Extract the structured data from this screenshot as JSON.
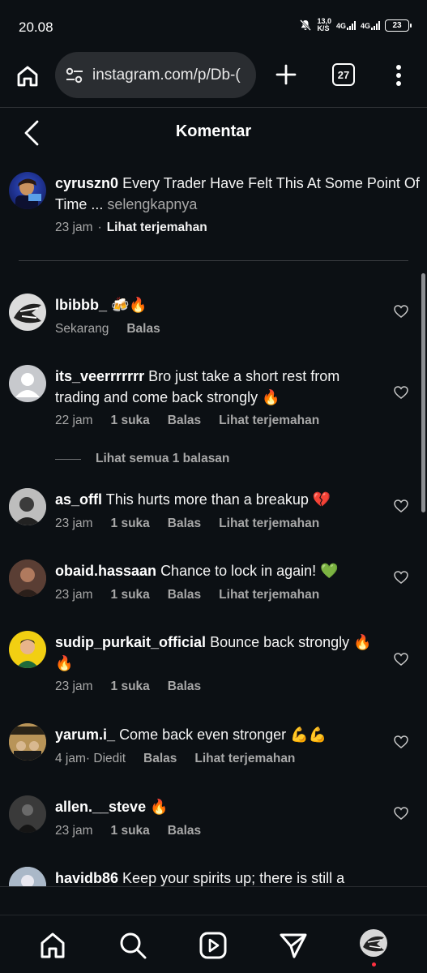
{
  "status_bar": {
    "time": "20.08",
    "speed_value": "13,0",
    "speed_unit": "K/S",
    "net1": "4G",
    "net2": "4G",
    "battery": "23"
  },
  "browser": {
    "url": "instagram.com/p/Db-(",
    "tab_count": "27"
  },
  "header": {
    "title": "Komentar"
  },
  "caption": {
    "username": "cyruszn0",
    "text": "Every Trader Have Felt This At Some Point Of Time ...",
    "more": "selengkapnya",
    "time": "23 jam",
    "translate": "Lihat terjemahan"
  },
  "comments": [
    {
      "username": "lbibbb_",
      "text": "🍻🔥",
      "time": "Sekarang",
      "likes": "",
      "reply": "Balas",
      "translate": ""
    },
    {
      "username": "its_veerrrrrrr",
      "text": "Bro just take a short rest from trading and come back strongly 🔥",
      "time": "22 jam",
      "likes": "1 suka",
      "reply": "Balas",
      "translate": "Lihat terjemahan"
    },
    {
      "username": "as_offl",
      "text": "This hurts more than a breakup 💔",
      "time": "23 jam",
      "likes": "1 suka",
      "reply": "Balas",
      "translate": "Lihat terjemahan"
    },
    {
      "username": "obaid.hassaan",
      "text": "Chance to lock in again! 💚",
      "time": "23 jam",
      "likes": "1 suka",
      "reply": "Balas",
      "translate": "Lihat terjemahan"
    },
    {
      "username": "sudip_purkait_official",
      "text": "Bounce back strongly 🔥🔥",
      "time": "23 jam",
      "likes": "1 suka",
      "reply": "Balas",
      "translate": ""
    },
    {
      "username": "yarum.i_",
      "text": "Come back even stronger 💪💪",
      "time": "4 jam· Diedit",
      "likes": "",
      "reply": "Balas",
      "translate": "Lihat terjemahan"
    },
    {
      "username": "allen.__steve",
      "text": "🔥",
      "time": "23 jam",
      "likes": "1 suka",
      "reply": "Balas",
      "translate": ""
    },
    {
      "username": "havidb86",
      "text": "Keep your spirits up; there is still a",
      "time": "",
      "likes": "",
      "reply": "",
      "translate": ""
    }
  ],
  "view_replies": "Lihat semua 1 balasan",
  "colors": {
    "background": "#0c1014",
    "muted": "#a8a8a8",
    "accent_red": "#ff3040"
  },
  "nav_icons": [
    "home-icon",
    "search-icon",
    "reels-icon",
    "direct-icon",
    "profile-avatar"
  ]
}
